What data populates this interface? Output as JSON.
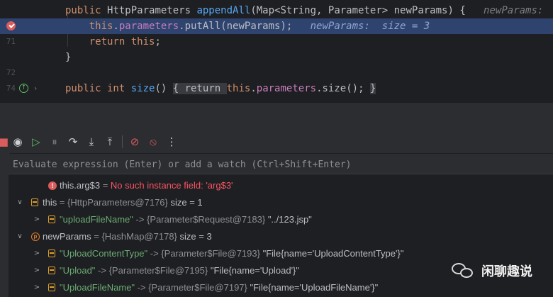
{
  "editor": {
    "lines": [
      {
        "num": "",
        "tokens": [
          [
            "kw",
            "public "
          ],
          [
            "",
            "HttpParameters "
          ],
          [
            "fn",
            "appendAll"
          ],
          [
            "",
            "(Map<String, Parameter> newParams) { "
          ],
          [
            "hint",
            "  newParams:  size"
          ]
        ]
      },
      {
        "num": "",
        "tokens": [
          [
            "",
            "    "
          ],
          [
            "kw",
            "this"
          ],
          [
            "",
            "."
          ],
          [
            "fld",
            "parameters"
          ],
          [
            "",
            ".putAll(newParams);"
          ],
          [
            "hint",
            "   newParams:  size = 3"
          ]
        ]
      },
      {
        "num": "71",
        "tokens": [
          [
            "",
            "    "
          ],
          [
            "kw",
            "return this"
          ],
          [
            "",
            ";"
          ]
        ]
      },
      {
        "num": "",
        "tokens": [
          [
            "",
            "}"
          ]
        ]
      },
      {
        "num": "72",
        "tokens": []
      },
      {
        "num": "74",
        "tokens": [
          [
            "kw",
            "public int "
          ],
          [
            "fn",
            "size"
          ],
          [
            "",
            "() "
          ],
          [
            "fold",
            "{"
          ],
          [
            "",
            ""
          ],
          [
            "fold",
            " return "
          ],
          [
            "fold",
            ""
          ],
          [
            "kw",
            "this"
          ],
          [
            "",
            "."
          ],
          [
            "fld",
            "parameters"
          ],
          [
            "",
            ".size(); "
          ],
          [
            "fold",
            "}"
          ]
        ]
      }
    ]
  },
  "debugger": {
    "toolbar": [
      {
        "name": "stop-icon",
        "glyph": "■"
      },
      {
        "name": "view-breakpoints-icon",
        "glyph": "◉"
      },
      {
        "name": "resume-icon",
        "glyph": "▷"
      },
      {
        "name": "pause-icon",
        "glyph": "⏸"
      },
      {
        "name": "step-over-icon",
        "glyph": "↷"
      },
      {
        "name": "step-into-icon",
        "glyph": "⤓"
      },
      {
        "name": "step-out-icon",
        "glyph": "⤒"
      },
      {
        "name": "sep",
        "glyph": ""
      },
      {
        "name": "mute-breakpoints-icon",
        "glyph": "⊘"
      },
      {
        "name": "clear-breakpoints-icon",
        "glyph": "⦸"
      },
      {
        "name": "more-icon",
        "glyph": "⋮"
      }
    ],
    "evaluate_placeholder": "Evaluate expression (Enter) or add a watch (Ctrl+Shift+Enter)",
    "variables": [
      {
        "indent": 1,
        "arrow": "",
        "icon": "error",
        "parts": [
          [
            "nm",
            "this.arg$3"
          ],
          [
            "gray",
            " = "
          ],
          [
            "errc",
            "No such instance field: 'arg$3'"
          ]
        ]
      },
      {
        "indent": 0,
        "arrow": "∨",
        "icon": "field",
        "parts": [
          [
            "nm",
            "this"
          ],
          [
            "gray",
            " = {HttpParameters@7176}"
          ],
          [
            "nm",
            "  size = 1"
          ]
        ]
      },
      {
        "indent": 1,
        "arrow": ">",
        "icon": "field",
        "parts": [
          [
            "str",
            "\"uploadFileName\""
          ],
          [
            "gray",
            " -> {Parameter$Request@7183} "
          ],
          [
            "nm",
            "\"../123.jsp\""
          ]
        ]
      },
      {
        "indent": 0,
        "arrow": "∨",
        "icon": "param",
        "parts": [
          [
            "nm",
            "newParams"
          ],
          [
            "gray",
            " = {HashMap@7178}"
          ],
          [
            "nm",
            "  size = 3"
          ]
        ]
      },
      {
        "indent": 1,
        "arrow": ">",
        "icon": "field",
        "parts": [
          [
            "str",
            "\"UploadContentType\""
          ],
          [
            "gray",
            " -> {Parameter$File@7193} "
          ],
          [
            "nm",
            "\"File{name='UploadContentType'}\""
          ]
        ]
      },
      {
        "indent": 1,
        "arrow": ">",
        "icon": "field",
        "parts": [
          [
            "str",
            "\"Upload\""
          ],
          [
            "gray",
            " -> {Parameter$File@7195} "
          ],
          [
            "nm",
            "\"File{name='Upload'}\""
          ]
        ]
      },
      {
        "indent": 1,
        "arrow": ">",
        "icon": "field",
        "parts": [
          [
            "str",
            "\"UploadFileName\""
          ],
          [
            "gray",
            " -> {Parameter$File@7197} "
          ],
          [
            "nm",
            "\"File{name='UploadFileName'}\""
          ]
        ]
      }
    ]
  },
  "watermark": {
    "text": "闲聊趣说"
  },
  "colors": {
    "highlight": "#2e436e",
    "keyword": "#cf8e6d",
    "method": "#56a8f5",
    "field": "#c77dbb",
    "string": "#6aab73",
    "error": "#f75464"
  }
}
